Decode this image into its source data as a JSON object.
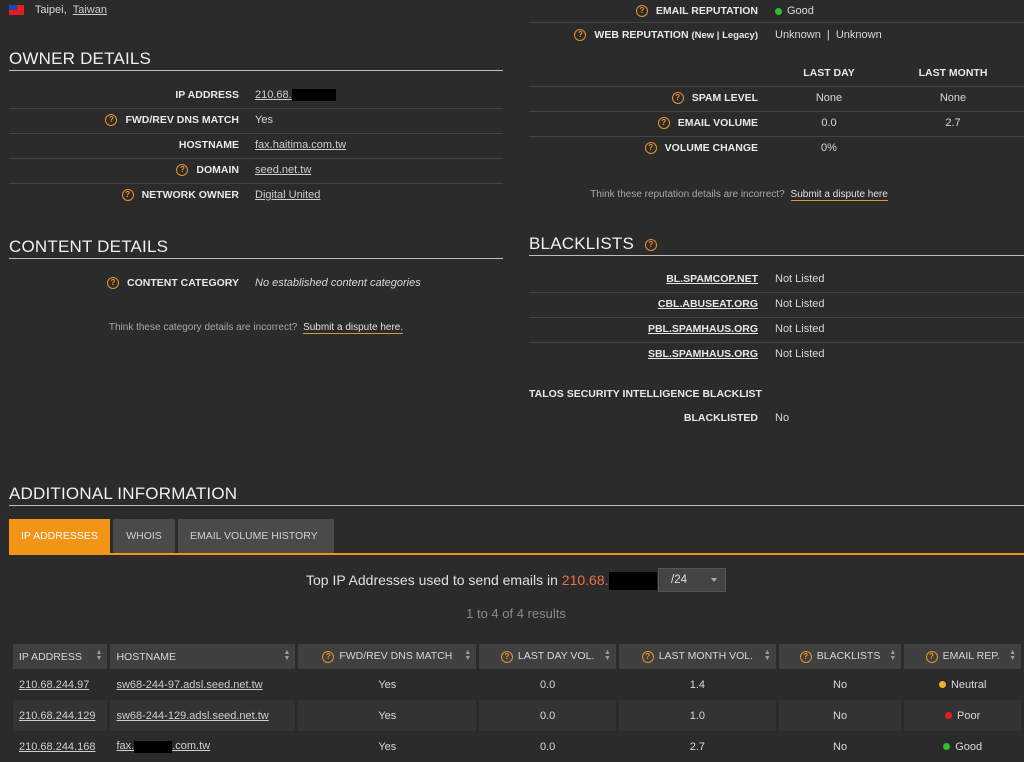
{
  "location": {
    "city": "Taipei,",
    "country": "Taiwan"
  },
  "owner": {
    "title": "OWNER DETAILS",
    "rows": [
      {
        "label": "IP ADDRESS",
        "value": "210.68."
      },
      {
        "label": "FWD/REV DNS MATCH",
        "value": "Yes"
      },
      {
        "label": "HOSTNAME",
        "value": "fax.haitima.com.tw"
      },
      {
        "label": "DOMAIN",
        "value": "seed.net.tw"
      },
      {
        "label": "NETWORK OWNER",
        "value": "Digital United"
      }
    ]
  },
  "content": {
    "title": "CONTENT DETAILS",
    "category_label": "CONTENT CATEGORY",
    "category_value": "No established content categories",
    "dispute_text": "Think these category details are incorrect?",
    "dispute_link": "Submit a dispute here."
  },
  "reputation": {
    "email_label": "EMAIL REPUTATION",
    "email_value": "Good",
    "web_label": "WEB REPUTATION",
    "web_label_suffix": "(New | Legacy)",
    "web_new": "Unknown",
    "web_sep": "|",
    "web_legacy": "Unknown",
    "col_last_day": "LAST DAY",
    "col_last_month": "LAST MONTH",
    "rows": [
      {
        "label": "SPAM LEVEL",
        "day": "None",
        "month": "None"
      },
      {
        "label": "EMAIL VOLUME",
        "day": "0.0",
        "month": "2.7"
      },
      {
        "label": "VOLUME CHANGE",
        "day": "0%",
        "month": ""
      }
    ],
    "dispute_text": "Think these reputation details are incorrect?",
    "dispute_link": "Submit a dispute here"
  },
  "blacklists": {
    "title": "BLACKLISTS",
    "rows": [
      {
        "name": "BL.SPAMCOP.NET",
        "status": "Not Listed"
      },
      {
        "name": "CBL.ABUSEAT.ORG",
        "status": "Not Listed"
      },
      {
        "name": "PBL.SPAMHAUS.ORG",
        "status": "Not Listed"
      },
      {
        "name": "SBL.SPAMHAUS.ORG",
        "status": "Not Listed"
      }
    ],
    "talos_title": "TALOS SECURITY INTELLIGENCE BLACKLIST",
    "talos_label": "BLACKLISTED",
    "talos_value": "No"
  },
  "additional": {
    "title": "ADDITIONAL INFORMATION",
    "tabs": [
      "IP ADDRESSES",
      "WHOIS",
      "EMAIL VOLUME HISTORY"
    ],
    "top_text": "Top IP Addresses used to send emails in",
    "top_ip": "210.68.",
    "subnet": "/24",
    "results": "1 to 4 of 4 results",
    "columns": [
      "IP ADDRESS",
      "HOSTNAME",
      "FWD/REV DNS MATCH",
      "LAST DAY VOL.",
      "LAST MONTH VOL.",
      "BLACKLISTS",
      "EMAIL REP."
    ],
    "rows": [
      {
        "ip": "210.68.244.97",
        "host": "sw68-244-97.adsl.seed.net.tw",
        "dns": "Yes",
        "day": "0.0",
        "month": "1.4",
        "bl": "No",
        "rep": "Neutral"
      },
      {
        "ip": "210.68.244.129",
        "host": "sw68-244-129.adsl.seed.net.tw",
        "dns": "Yes",
        "day": "0.0",
        "month": "1.0",
        "bl": "No",
        "rep": "Poor"
      },
      {
        "ip": "210.68.244.168",
        "host_a": "fax.",
        "host_b": ".com.tw",
        "dns": "Yes",
        "day": "0.0",
        "month": "2.7",
        "bl": "No",
        "rep": "Good"
      }
    ]
  },
  "colors": {
    "accent": "#f29415",
    "good": "#2ec12e",
    "neutral": "#f0b323",
    "poor": "#e02020"
  }
}
